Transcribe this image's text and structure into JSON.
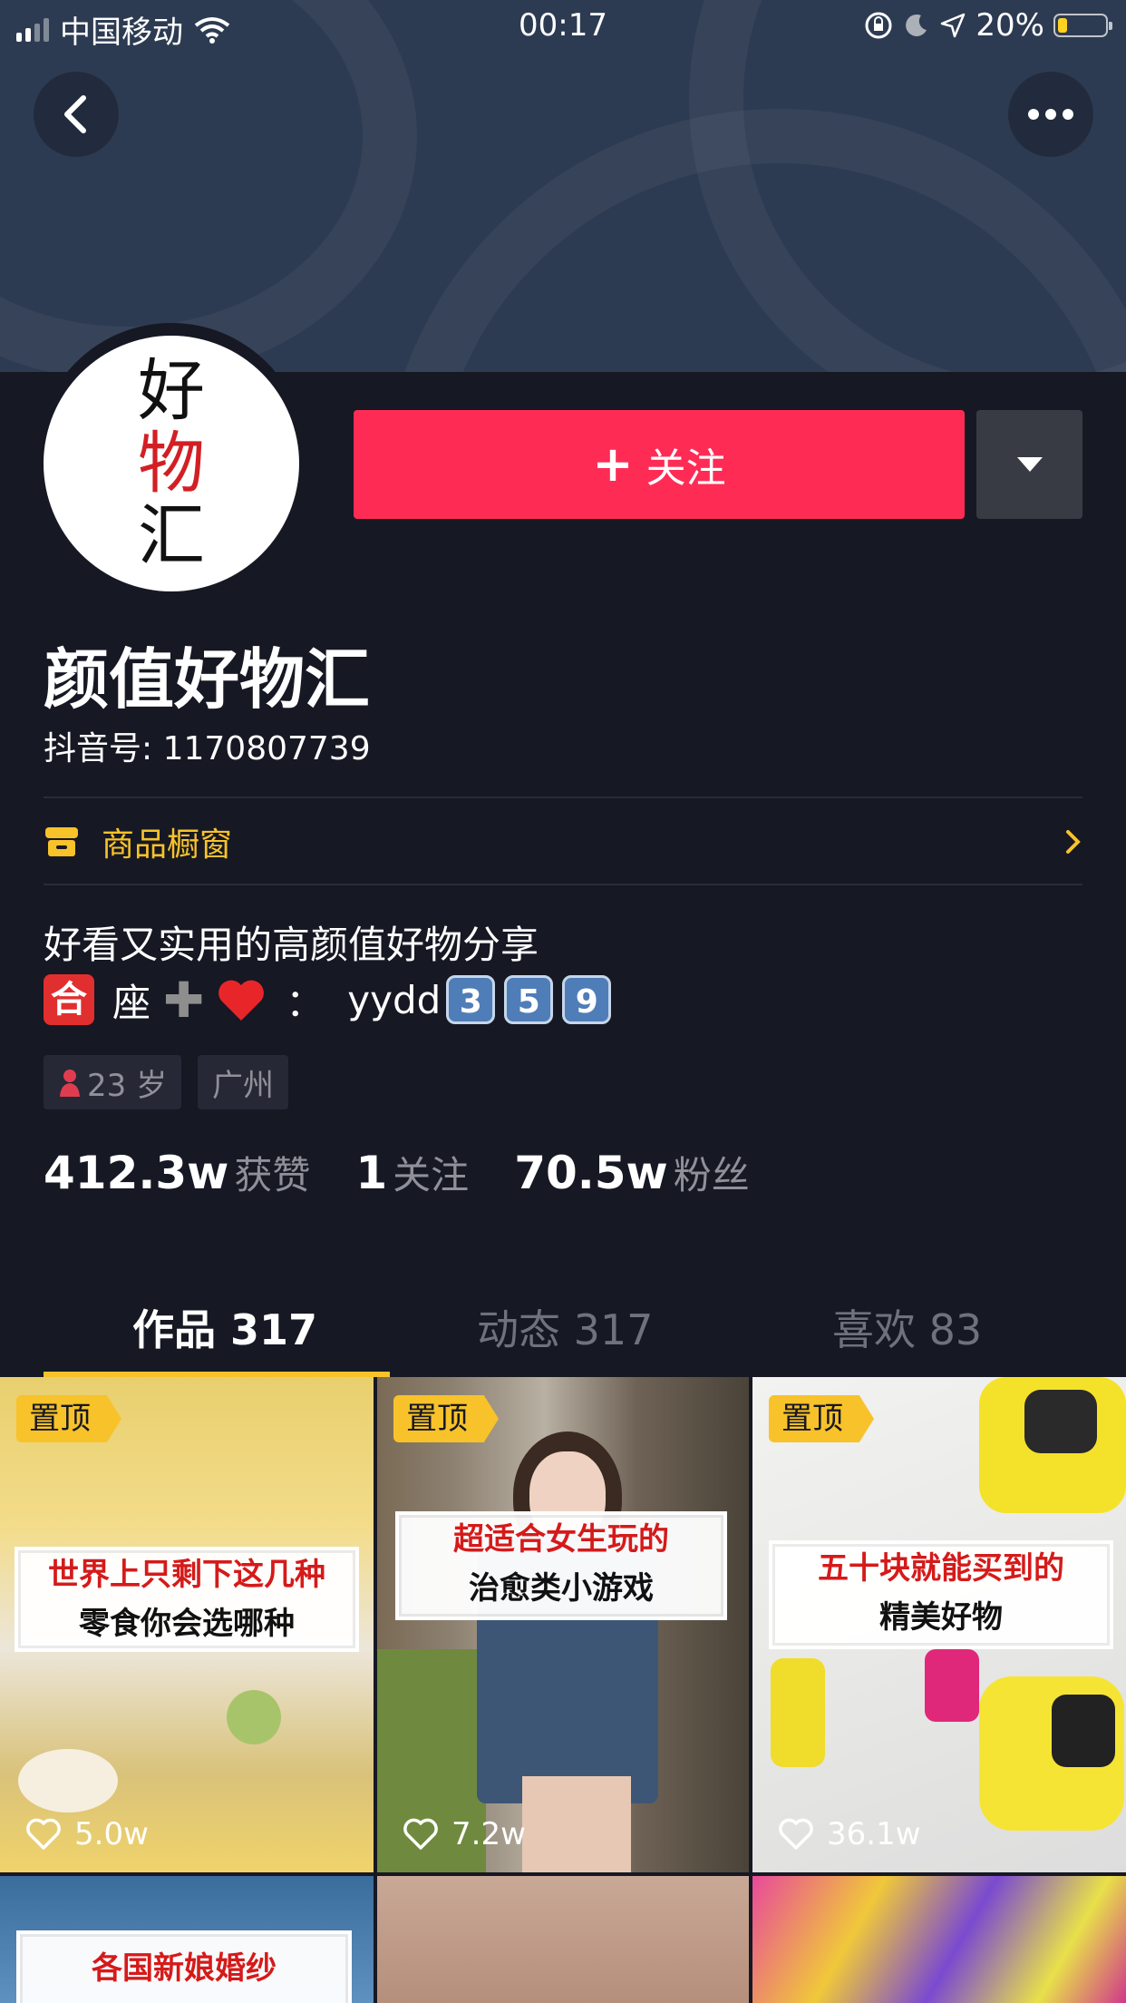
{
  "status_bar": {
    "carrier": "中国移动",
    "time": "00:17",
    "battery_percent": "20%",
    "battery_level": 0.2
  },
  "avatar": {
    "chars": [
      "好",
      "物",
      "汇"
    ]
  },
  "follow_button": {
    "label": "关注"
  },
  "profile": {
    "nickname": "颜值好物汇",
    "douyin_id": "抖音号: 1170807739",
    "shop_label": "商品橱窗",
    "bio_line1": "好看又实用的高颜值好物分享",
    "bio_he": "合",
    "bio_seat": "座",
    "bio_colon": "：",
    "bio_contact": "yydd",
    "bio_keycaps": [
      "3",
      "5",
      "9"
    ],
    "age_tag": "23 岁",
    "location_tag": "广州"
  },
  "stats": [
    {
      "num": "412.3w",
      "label": "获赞"
    },
    {
      "num": "1",
      "label": "关注"
    },
    {
      "num": "70.5w",
      "label": "粉丝"
    }
  ],
  "tabs": [
    {
      "label": "作品 317",
      "active": true
    },
    {
      "label": "动态 317",
      "active": false
    },
    {
      "label": "喜欢 83",
      "active": false
    }
  ],
  "videos": [
    {
      "pinned": "置顶",
      "caption_l1": "世界上只剩下这几种",
      "caption_l2": "零食你会选哪种",
      "likes": "5.0w"
    },
    {
      "pinned": "置顶",
      "caption_l1": "超适合女生玩的",
      "caption_l2": "治愈类小游戏",
      "likes": "7.2w"
    },
    {
      "pinned": "置顶",
      "caption_l1": "五十块就能买到的",
      "caption_l2": "精美好物",
      "likes": "36.1w"
    },
    {
      "caption_l1": "各国新娘婚纱"
    }
  ],
  "colors": {
    "background": "#161823",
    "follow": "#fe2c55",
    "accent_yellow": "#f8c22a"
  },
  "icons": [
    "back-icon",
    "more-icon",
    "dropdown-icon",
    "shop-icon",
    "chevron-right-icon",
    "female-icon",
    "heart-icon"
  ]
}
